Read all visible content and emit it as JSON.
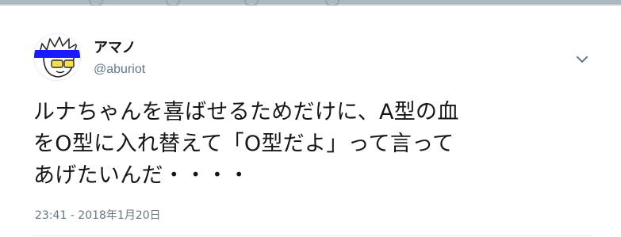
{
  "tweet": {
    "author": {
      "display_name": "アマノ",
      "handle": "@aburiot"
    },
    "text_lines": [
      "ルナちゃんを喜ばせるためだけに、A型の血",
      "をO型に入れ替えて「O型だよ」って言って",
      "あげたいんだ・・・・"
    ],
    "timestamp": "23:41 - 2018年1月20日"
  },
  "icons": {
    "menu": "chevron-down-icon"
  },
  "colors": {
    "text": "#14171a",
    "secondary_text": "#657786",
    "censor_bar": "#1a1aff",
    "glasses": "#f5e04a",
    "divider": "#e6ecf0"
  }
}
